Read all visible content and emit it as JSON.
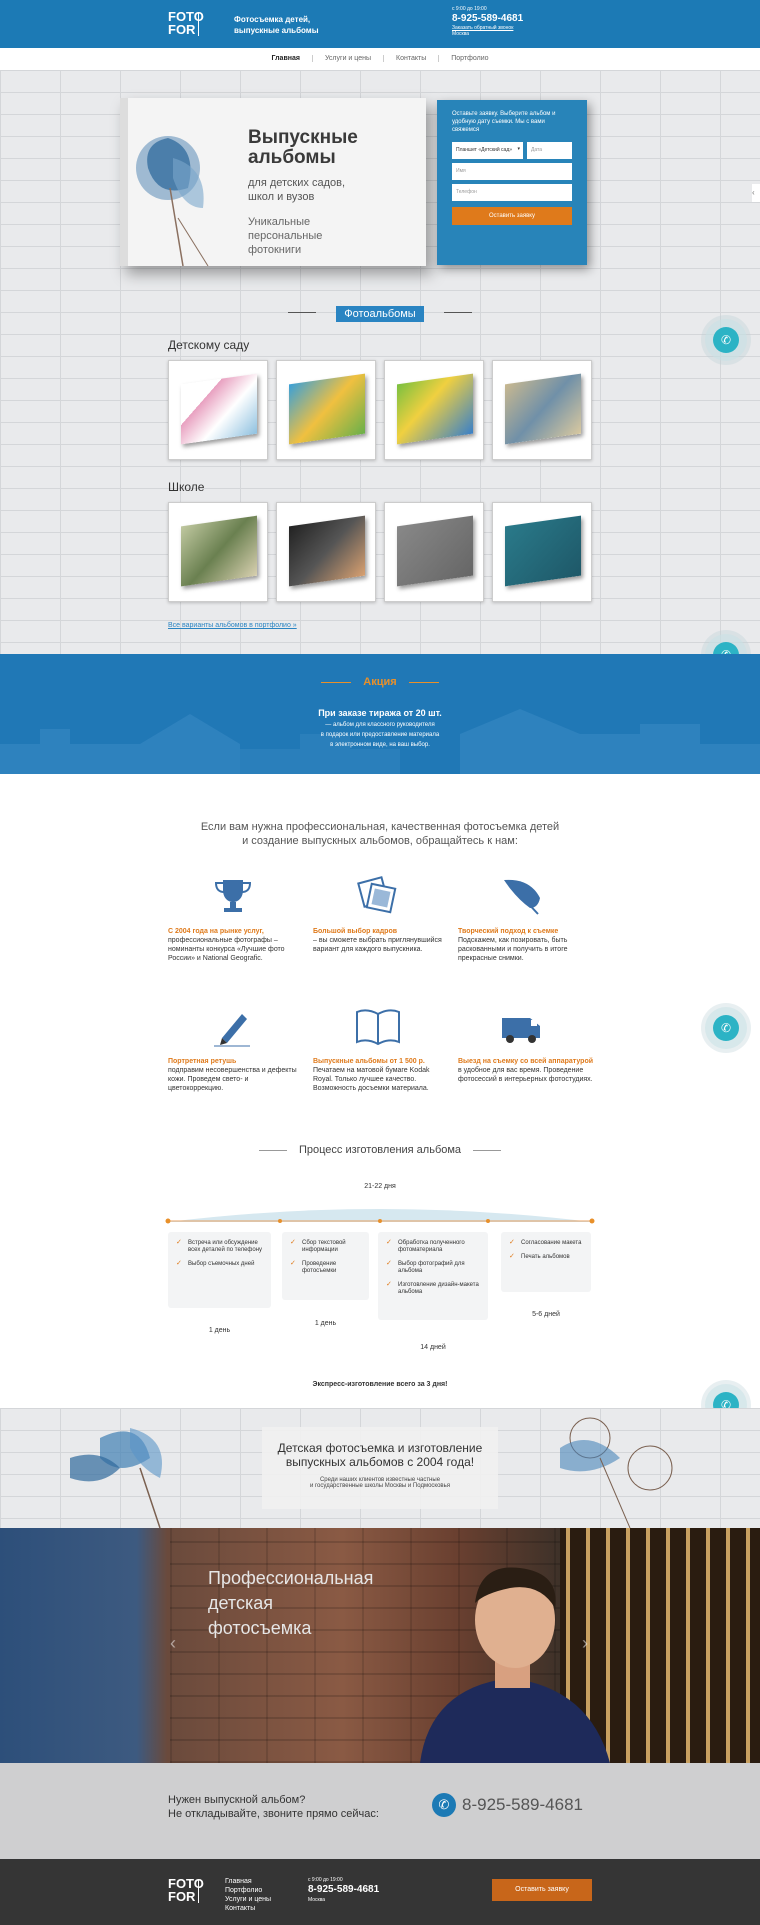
{
  "header": {
    "logo_top": "FOTO",
    "logo_bottom": "FOR",
    "tagline": "Фотосъемка детей, выпускные альбомы",
    "hours": "с 9:00 до 19:00",
    "phone": "8-925-589-4681",
    "callback_link": "Заказать обратный звонок",
    "city": "Москва"
  },
  "nav": {
    "items": [
      "Главная",
      "Услуги и цены",
      "Контакты",
      "Портфолио"
    ]
  },
  "hero": {
    "title": "Выпускные альбомы",
    "subtitle": "для детских садов, школ и вузов",
    "subtitle2": "Уникальные персональные фотокниги",
    "form": {
      "intro": "Оставьте заявку. Выберите альбом и удобную дату съемки. Мы с вами свяжемся",
      "select_value": "Планшет «Детский сад»",
      "date_placeholder": "Дата",
      "name_placeholder": "Имя",
      "phone_placeholder": "Телефон",
      "submit": "Оставить заявку"
    }
  },
  "albums": {
    "section_label": "Фотоальбомы",
    "kindergarten_title": "Детскому саду",
    "school_title": "Школе",
    "portfolio_link": "Все варианты альбомов в портфолио »"
  },
  "promo": {
    "title": "Акция",
    "headline": "При заказе тиража от 20 шт.",
    "line1": "— альбом для классного руководителя",
    "line2": "в подарок или предоставление материала",
    "line3": "в электронном виде, на ваш выбор."
  },
  "features": {
    "intro_line1": "Если вам нужна профессиональная, качественная фотосъемка детей",
    "intro_line2": "и создание выпускных альбомов, обращайтесь к нам:",
    "items": [
      {
        "title": "С 2004 года на рынке услуг,",
        "text": "профессиональные фотографы – номинанты конкурса «Лучшие фото России» и National Geografic.",
        "icon": "trophy-icon"
      },
      {
        "title": "Большой выбор кадров",
        "text": "– вы сможете выбрать приглянувшийся вариант для каждого выпускника.",
        "icon": "photos-icon"
      },
      {
        "title": "Творческий подход к съемке",
        "text": "Подскажем, как позировать, быть раскованными и получить в итоге прекрасные снимки.",
        "icon": "feather-icon"
      },
      {
        "title": "Портретная ретушь",
        "text": "подправим несовершенства и дефекты кожи. Проведем свето- и цветокоррекцию.",
        "icon": "pencil-icon"
      },
      {
        "title": "Выпускные альбомы от 1 500 р.",
        "text": "Печатаем на матовой бумаге Kodak Royal. Только лучшее качество. Возможность досъемки материала.",
        "icon": "book-icon"
      },
      {
        "title": "Выезд на съемку со всей аппаратурой",
        "text": "в удобное для вас время. Проведение фотосессий в интерьерных фотостудиях.",
        "icon": "van-icon"
      }
    ]
  },
  "process": {
    "title": "Процесс изготовления альбома",
    "total": "21-22 дня",
    "steps": [
      {
        "items": [
          "Встреча или обсуждение всех деталей по телефону",
          "Выбор съемочных дней"
        ],
        "duration": "1 день"
      },
      {
        "items": [
          "Сбор текстовой информации",
          "Проведение фотосъемки"
        ],
        "duration": "1 день"
      },
      {
        "items": [
          "Обработка полученного фотоматериала",
          "Выбор фотографий для альбома",
          "Изготовление дизайн-макета альбома"
        ],
        "duration": "14 дней"
      },
      {
        "items": [
          "Согласование макета",
          "Печать альбомов"
        ],
        "duration": "5-6 дней"
      }
    ],
    "express": "Экспресс-изготовление всего за 3 дня!"
  },
  "banner": {
    "title_line1": "Детская фотосъемка и изготовление",
    "title_line2": "выпускных альбомов с 2004 года!",
    "sub_line1": "Среди наших клиентов известные частные",
    "sub_line2": "и государственные школы Москвы и Подмосковья"
  },
  "slider": {
    "caption_line1": "Профессиональная",
    "caption_line2": "детская",
    "caption_line3": "фотосъемка"
  },
  "cta": {
    "line1": "Нужен выпускной альбом?",
    "line2": "Не откладывайте, звоните прямо сейчас:",
    "phone": "8-925-589-4681"
  },
  "footer": {
    "links": [
      "Главная",
      "Портфолио",
      "Услуги и цены",
      "Контакты"
    ],
    "hours": "с 9:00 до 19:00",
    "phone": "8-925-589-4681",
    "city": "Москва",
    "button": "Оставить заявку"
  },
  "colors": {
    "primary": "#1c7ab5",
    "accent": "#df7a1b",
    "call": "#2cb3c5"
  }
}
